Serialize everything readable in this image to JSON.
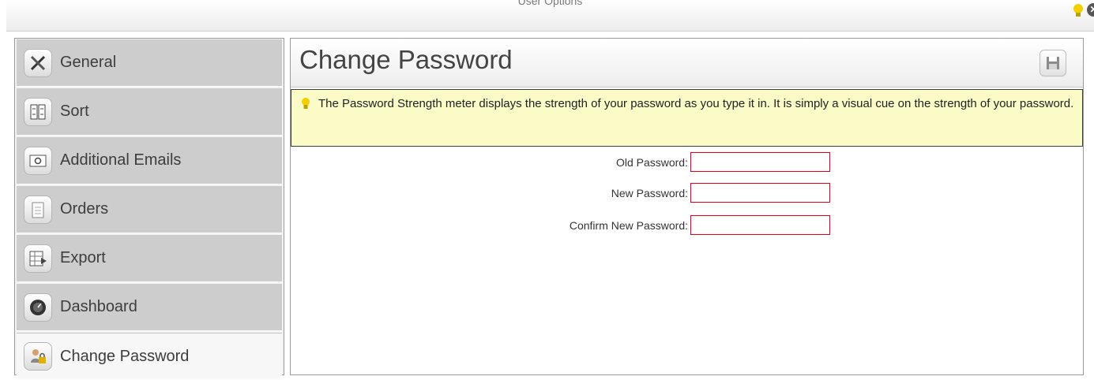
{
  "window": {
    "title": "User Options"
  },
  "sidebar": {
    "items": [
      {
        "label": "General",
        "icon": "tools-icon",
        "active": false
      },
      {
        "label": "Sort",
        "icon": "sort-icon",
        "active": false
      },
      {
        "label": "Additional Emails",
        "icon": "email-icon",
        "active": false
      },
      {
        "label": "Orders",
        "icon": "clipboard-icon",
        "active": false
      },
      {
        "label": "Export",
        "icon": "export-icon",
        "active": false
      },
      {
        "label": "Dashboard",
        "icon": "gauge-icon",
        "active": false
      },
      {
        "label": "Change Password",
        "icon": "user-lock-icon",
        "active": true
      }
    ]
  },
  "main": {
    "title": "Change Password",
    "save_icon": "save-icon",
    "info": "The Password Strength meter displays the strength of your password as you type it in. It is simply a visual cue on the strength of your password.",
    "form": {
      "old_password_label": "Old Password:",
      "old_password_value": "",
      "new_password_label": "New Password:",
      "new_password_value": "",
      "confirm_password_label": "Confirm New Password:",
      "confirm_password_value": ""
    }
  },
  "colors": {
    "sidebar_item_bg": "#cdcdcd",
    "sidebar_active_bg": "#f7f7f7",
    "info_bg": "#fbfbc8",
    "input_border": "#e0000f"
  }
}
